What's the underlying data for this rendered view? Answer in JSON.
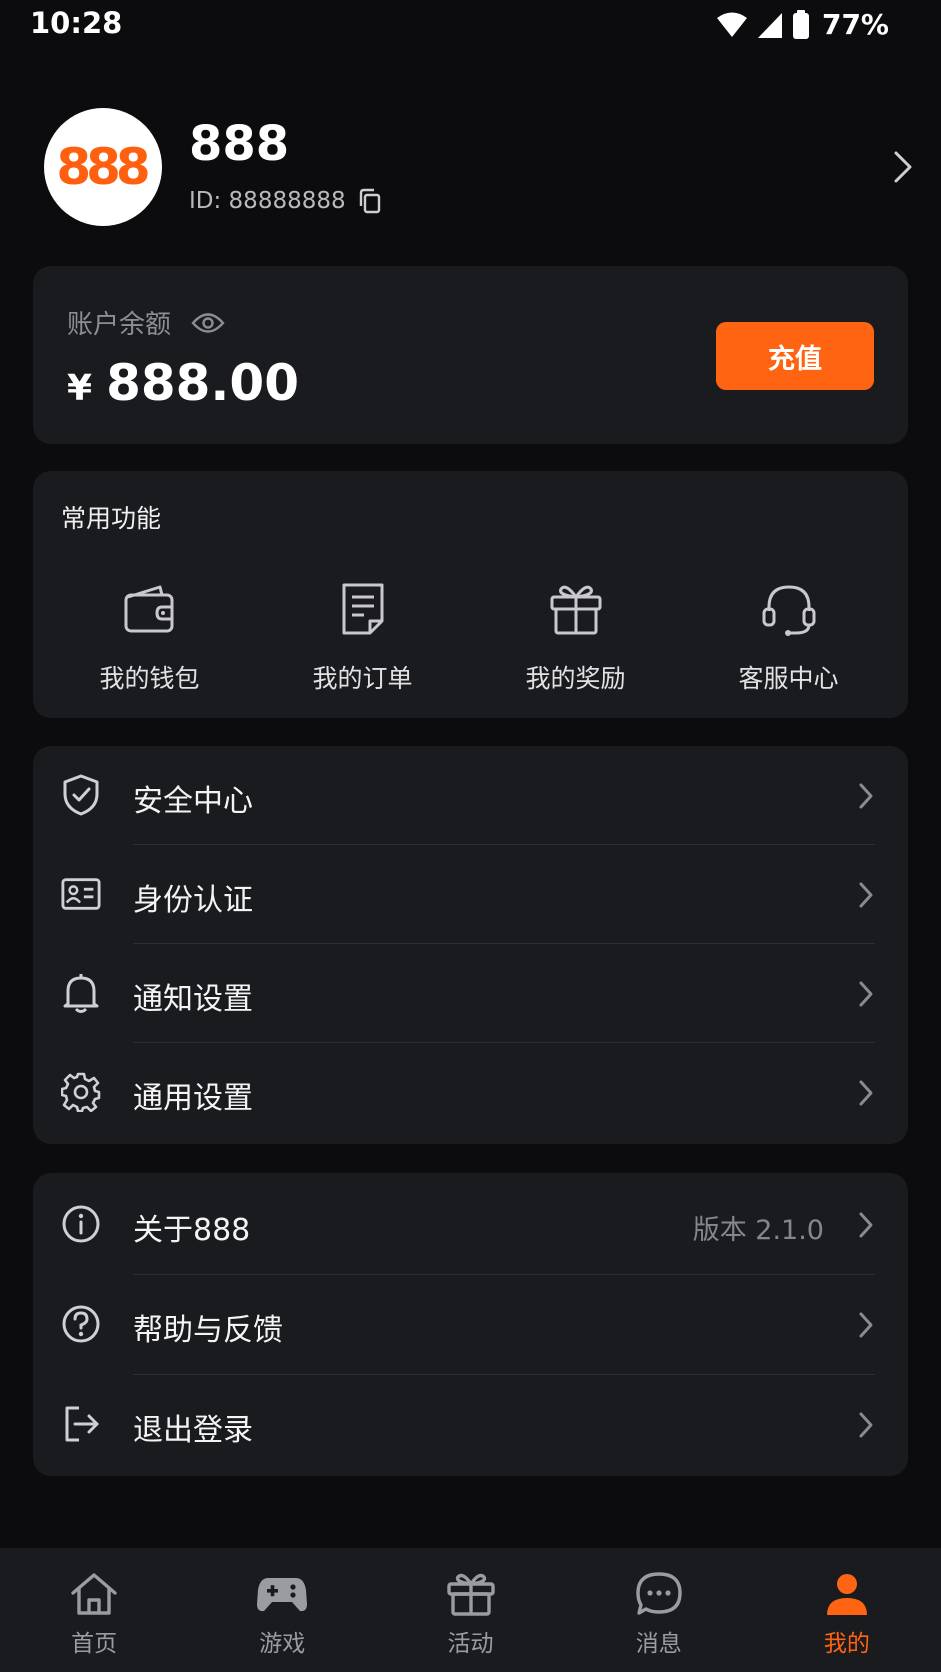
{
  "status_bar": {
    "time": "10:28",
    "battery": "77%"
  },
  "profile": {
    "avatar_text": "888",
    "name": "888",
    "id_label": "ID: 88888888"
  },
  "balance": {
    "label": "账户余额",
    "currency": "¥",
    "amount": "888.00",
    "recharge_label": "充值"
  },
  "functions": {
    "title": "常用功能",
    "items": [
      {
        "label": "我的钱包",
        "icon": "wallet-icon"
      },
      {
        "label": "我的订单",
        "icon": "order-icon"
      },
      {
        "label": "我的奖励",
        "icon": "gift-icon"
      },
      {
        "label": "客服中心",
        "icon": "headset-icon"
      }
    ]
  },
  "settings_menu": [
    {
      "label": "安全中心",
      "icon": "shield-icon"
    },
    {
      "label": "身份认证",
      "icon": "id-card-icon"
    },
    {
      "label": "通知设置",
      "icon": "bell-icon"
    },
    {
      "label": "通用设置",
      "icon": "gear-icon"
    }
  ],
  "about_menu": [
    {
      "label": "关于888",
      "icon": "info-icon",
      "value": "版本 2.1.0"
    },
    {
      "label": "帮助与反馈",
      "icon": "help-icon"
    },
    {
      "label": "退出登录",
      "icon": "logout-icon"
    }
  ],
  "tab_bar": [
    {
      "label": "首页",
      "icon": "home-icon"
    },
    {
      "label": "游戏",
      "icon": "gamepad-icon"
    },
    {
      "label": "活动",
      "icon": "gift-icon"
    },
    {
      "label": "消息",
      "icon": "message-icon"
    },
    {
      "label": "我的",
      "icon": "user-icon",
      "active": true
    }
  ],
  "colors": {
    "accent": "#ff6412",
    "background": "#0c0c0e",
    "card": "#1a1b1f"
  }
}
